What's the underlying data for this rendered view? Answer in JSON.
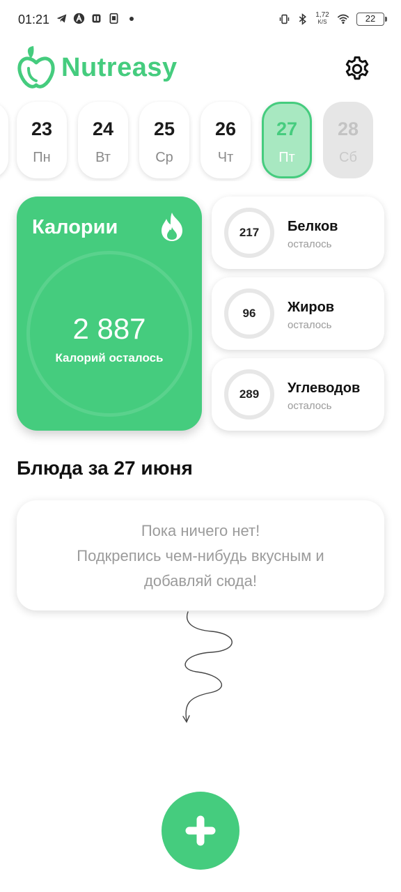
{
  "status_bar": {
    "time": "01:21",
    "left_icons": [
      "telegram-icon",
      "app-a-icon",
      "app-notification-icon",
      "sim-icon",
      "more-dot-icon"
    ],
    "net_speed_value": "1,72",
    "net_speed_unit": "K/S",
    "battery": "22"
  },
  "header": {
    "app_name": "Nutreasy",
    "settings_icon": "gear-icon"
  },
  "days": [
    {
      "num": "23",
      "name": "Пн",
      "state": "normal"
    },
    {
      "num": "24",
      "name": "Вт",
      "state": "normal"
    },
    {
      "num": "25",
      "name": "Ср",
      "state": "normal"
    },
    {
      "num": "26",
      "name": "Чт",
      "state": "normal"
    },
    {
      "num": "27",
      "name": "Пт",
      "state": "active"
    },
    {
      "num": "28",
      "name": "Сб",
      "state": "future"
    }
  ],
  "calories": {
    "title": "Калории",
    "value": "2 887",
    "caption": "Калорий осталось"
  },
  "macros": [
    {
      "value": "217",
      "name": "Белков",
      "sub": "осталось"
    },
    {
      "value": "96",
      "name": "Жиров",
      "sub": "осталось"
    },
    {
      "value": "289",
      "name": "Углеводов",
      "sub": "осталось"
    }
  ],
  "meals": {
    "title": "Блюда за 27 июня",
    "empty_lines": [
      "Пока ничего нет!",
      "Подкрепись чем-нибудь вкусным и",
      "добавляй сюда!"
    ]
  },
  "colors": {
    "accent": "#45cc7e",
    "accent_light": "#a8e8c1",
    "muted_text": "#9b9b9b"
  }
}
